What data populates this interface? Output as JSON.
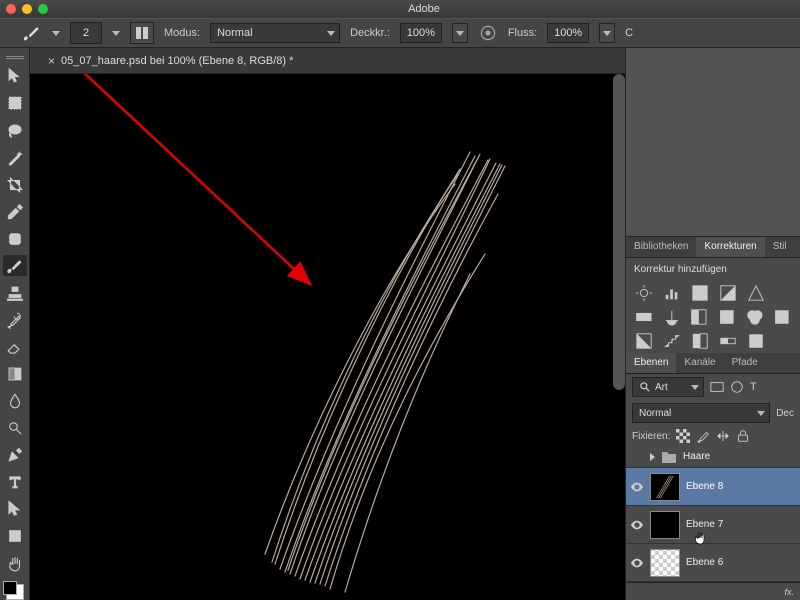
{
  "window": {
    "app_title": "Adobe"
  },
  "optionsbar": {
    "brush_size": "2",
    "mode_label": "Modus:",
    "mode_value": "Normal",
    "opacity_label": "Deckkr.:",
    "opacity_value": "100%",
    "flow_label": "Fluss:",
    "flow_value": "100%"
  },
  "document": {
    "tab_title": "05_07_haare.psd bei 100% (Ebene 8, RGB/8) *"
  },
  "right": {
    "tabs_top": {
      "bibliotheken": "Bibliotheken",
      "korrekturen": "Korrekturen",
      "stil": "Stil"
    },
    "adjustments_title": "Korrektur hinzufügen",
    "layers_tabs": {
      "ebenen": "Ebenen",
      "kanaele": "Kanäle",
      "pfade": "Pfade"
    },
    "filter_label": "Art",
    "blend_mode": "Normal",
    "opacity_short": "Dec",
    "lock_label": "Fixieren:"
  },
  "layers": {
    "group": "Haare",
    "l8": "Ebene 8",
    "l7": "Ebene 7",
    "l6": "Ebene 6"
  }
}
